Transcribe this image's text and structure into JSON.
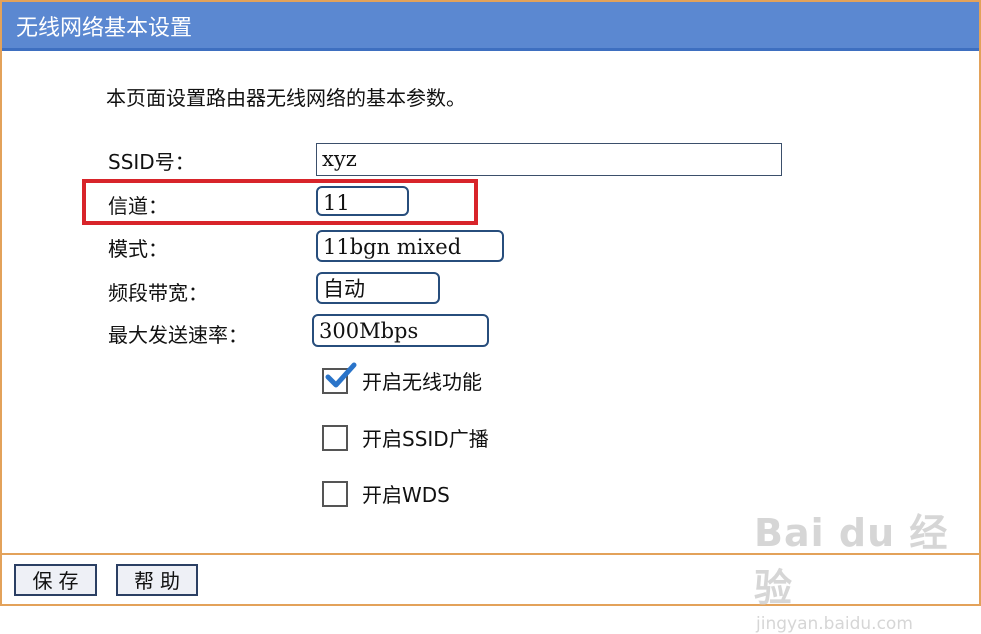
{
  "window": {
    "title": "无线网络基本设置"
  },
  "description": "本页面设置路由器无线网络的基本参数。",
  "fields": {
    "ssid": {
      "label": "SSID号：",
      "value": "xyz"
    },
    "channel": {
      "label": "信道：",
      "value": "11"
    },
    "mode": {
      "label": "模式：",
      "value": "11bgn mixed"
    },
    "bandwidth": {
      "label": "频段带宽：",
      "value": "自动"
    },
    "max_rate": {
      "label": "最大发送速率：",
      "value": "300Mbps"
    }
  },
  "options": [
    {
      "label": "开启无线功能",
      "checked": true
    },
    {
      "label": "开启SSID广播",
      "checked": false
    },
    {
      "label": "开启WDS",
      "checked": false
    }
  ],
  "buttons": {
    "save": "保存",
    "help": "帮助"
  },
  "watermark": {
    "brand": "Bai du 经验",
    "url": "jingyan.baidu.com"
  },
  "colors": {
    "title_bar": "#5b88d1",
    "frame_border": "#e3a25a",
    "highlight": "#d8242a",
    "checkmark": "#2a74c9"
  }
}
